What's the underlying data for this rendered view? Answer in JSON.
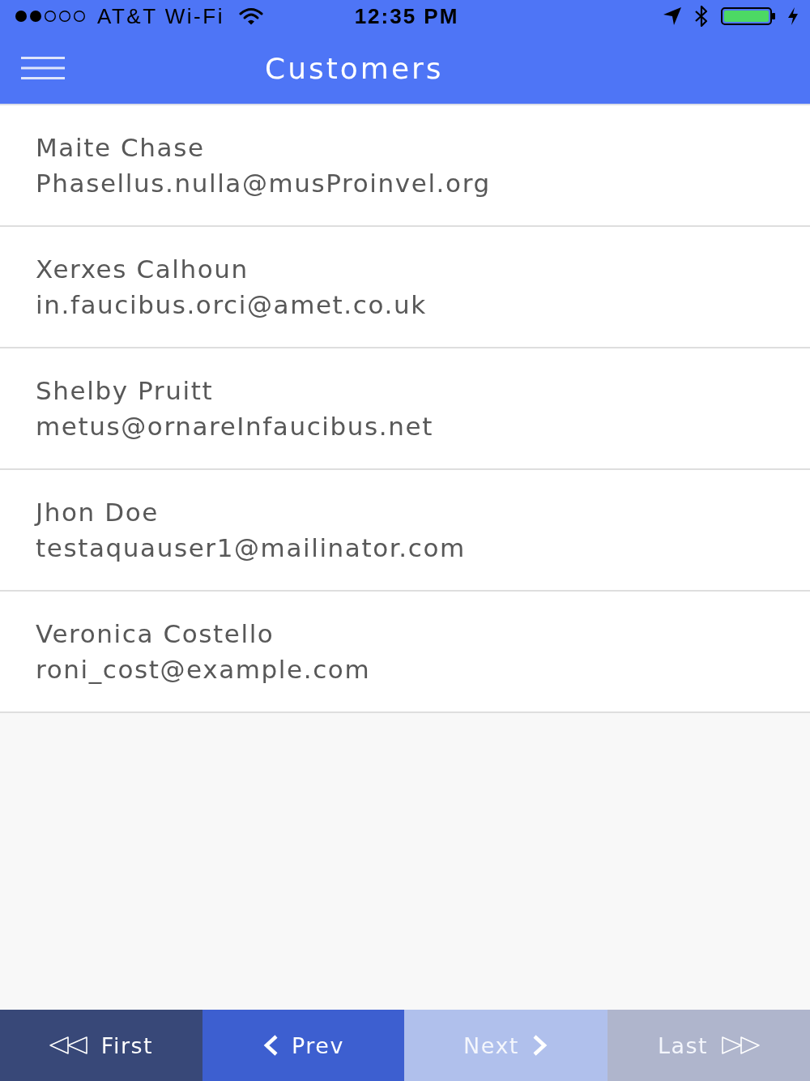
{
  "status_bar": {
    "carrier": "AT&T Wi-Fi",
    "time": "12:35 PM"
  },
  "nav_bar": {
    "title": "Customers"
  },
  "customers": [
    {
      "name": "Maite Chase",
      "email": "Phasellus.nulla@musProinvel.org"
    },
    {
      "name": "Xerxes Calhoun",
      "email": "in.faucibus.orci@amet.co.uk"
    },
    {
      "name": "Shelby Pruitt",
      "email": "metus@ornareInfaucibus.net"
    },
    {
      "name": "Jhon Doe",
      "email": "testaquauser1@mailinator.com"
    },
    {
      "name": "Veronica Costello",
      "email": "roni_cost@example.com"
    }
  ],
  "pagination": [
    {
      "kind": "first",
      "label": "First",
      "disabled": false
    },
    {
      "kind": "prev",
      "label": "Prev",
      "disabled": false
    },
    {
      "kind": "next",
      "label": "Next",
      "disabled": true
    },
    {
      "kind": "last",
      "label": "Last",
      "disabled": true
    }
  ]
}
